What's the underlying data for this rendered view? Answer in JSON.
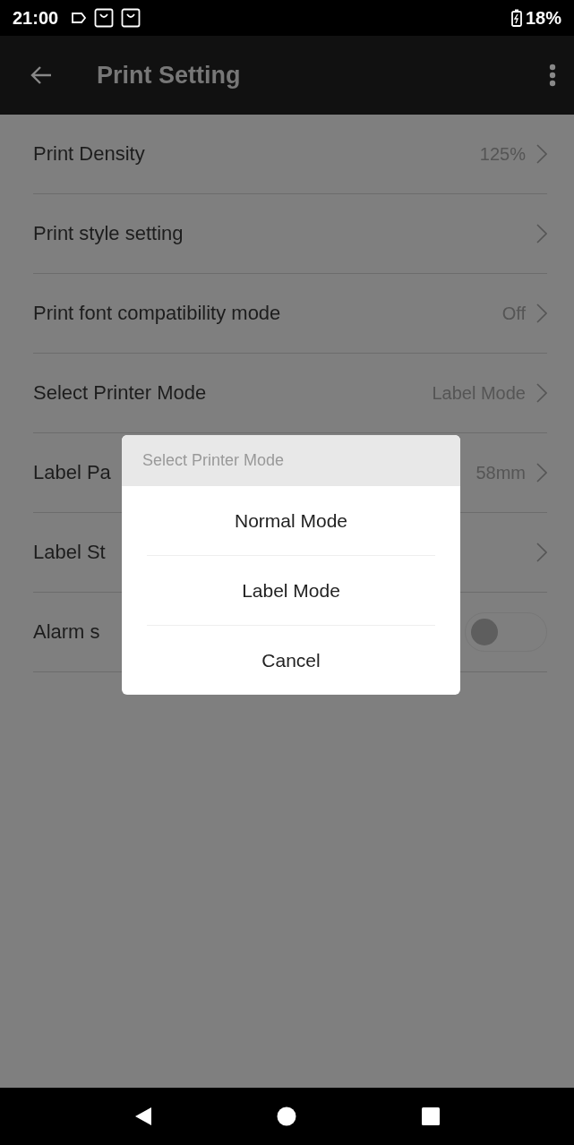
{
  "status_bar": {
    "time": "21:00",
    "battery": "18%"
  },
  "app_bar": {
    "title": "Print Setting"
  },
  "settings": [
    {
      "kind": "link",
      "label": "Print Density",
      "value": "125%"
    },
    {
      "kind": "link",
      "label": "Print style setting"
    },
    {
      "kind": "link",
      "label": "Print font compatibility mode",
      "value": "Off"
    },
    {
      "kind": "link",
      "label": "Select Printer Mode",
      "value": "Label Mode"
    },
    {
      "kind": "link",
      "label": "Label Pa",
      "value": "58mm"
    },
    {
      "kind": "link",
      "label": "Label St"
    },
    {
      "kind": "toggle",
      "label": "Alarm s",
      "on": false
    }
  ],
  "dialog": {
    "title": "Select Printer Mode",
    "options": [
      "Normal Mode",
      "Label Mode",
      "Cancel"
    ]
  }
}
